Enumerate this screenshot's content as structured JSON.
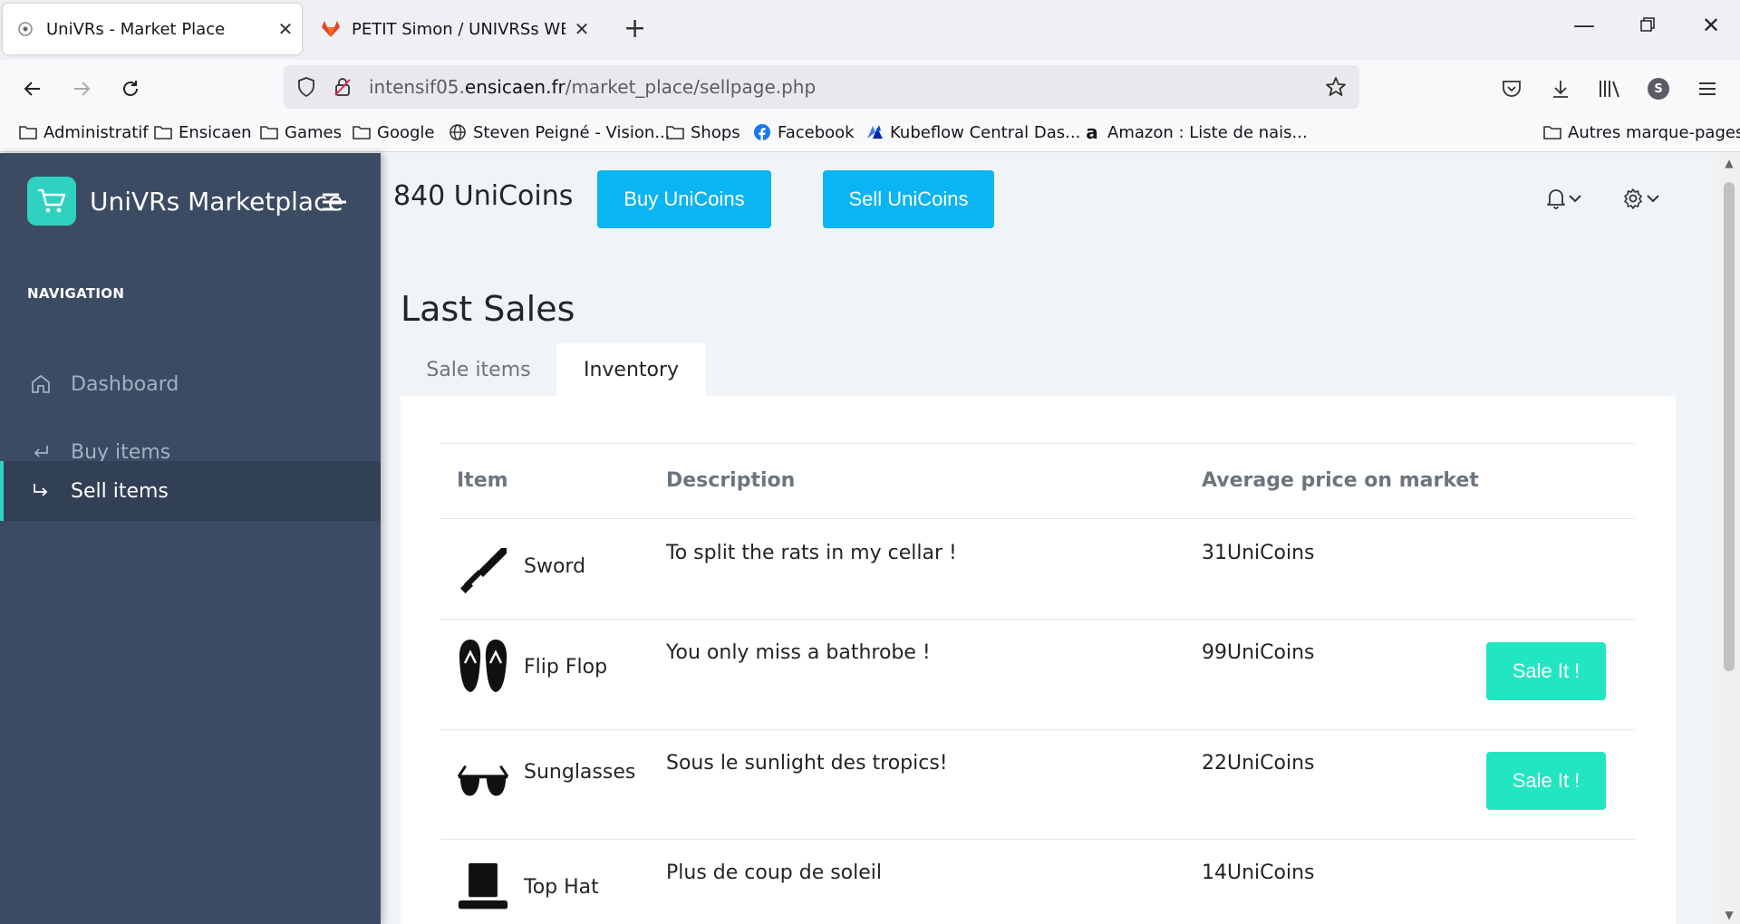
{
  "browser": {
    "tabs": [
      {
        "title": "UniVRs - Market Place",
        "active": true
      },
      {
        "title": "PETIT Simon / UNIVRSs WEBSIT",
        "active": false
      }
    ],
    "url_prefix": "intensif05.",
    "url_domain": "ensicaen.fr",
    "url_path": "/market_place/sellpage.php",
    "profile_initial": "S",
    "bookmarks": [
      {
        "label": "Administratif",
        "icon": "folder-icon"
      },
      {
        "label": "Ensicaen",
        "icon": "folder-icon"
      },
      {
        "label": "Games",
        "icon": "folder-icon"
      },
      {
        "label": "Google",
        "icon": "folder-icon"
      },
      {
        "label": "Steven Peigné - Vision...",
        "icon": "globe-icon"
      },
      {
        "label": "Shops",
        "icon": "folder-icon"
      },
      {
        "label": "Facebook",
        "icon": "facebook-icon"
      },
      {
        "label": "Kubeflow Central Das...",
        "icon": "kubeflow-icon"
      },
      {
        "label": "Amazon : Liste de nais...",
        "icon": "amazon-icon"
      }
    ],
    "other_bookmarks": "Autres marque-pages"
  },
  "sidebar": {
    "brand": "UniVRs Marketplace",
    "heading": "NAVIGATION",
    "items": [
      {
        "label": "Dashboard",
        "icon": "home-icon",
        "active": false
      },
      {
        "label": "Buy items",
        "icon": "arrow-return-left-icon",
        "active": false
      },
      {
        "label": "Sell items",
        "icon": "arrow-return-right-icon",
        "active": true
      }
    ]
  },
  "header": {
    "coins": "840 UniCoins",
    "buy_label": "Buy UniCoins",
    "sell_label": "Sell UniCoins"
  },
  "main": {
    "title": "Last Sales",
    "tabs": [
      {
        "label": "Sale items",
        "active": false
      },
      {
        "label": "Inventory",
        "active": true
      }
    ],
    "table": {
      "headers": [
        "Item",
        "Description",
        "Average price on market"
      ],
      "rows": [
        {
          "name": "Sword",
          "description": "To split the rats in my cellar !",
          "price": "31UniCoins",
          "icon": "sword-icon",
          "action": ""
        },
        {
          "name": "Flip Flop",
          "description": "You only miss a bathrobe !",
          "price": "99UniCoins",
          "icon": "flip-flop-icon",
          "action": "Sale It !"
        },
        {
          "name": "Sunglasses",
          "description": "Sous le sunlight des tropics!",
          "price": "22UniCoins",
          "icon": "sunglasses-icon",
          "action": "Sale It !"
        },
        {
          "name": "Top Hat",
          "description": "Plus de coup de soleil",
          "price": "14UniCoins",
          "icon": "top-hat-icon",
          "action": ""
        }
      ]
    }
  },
  "colors": {
    "sidebar_bg": "#3b4b63",
    "accent_teal": "#2fd2c0",
    "button_blue": "#0bb4f2",
    "sale_button": "#21e6c1"
  }
}
